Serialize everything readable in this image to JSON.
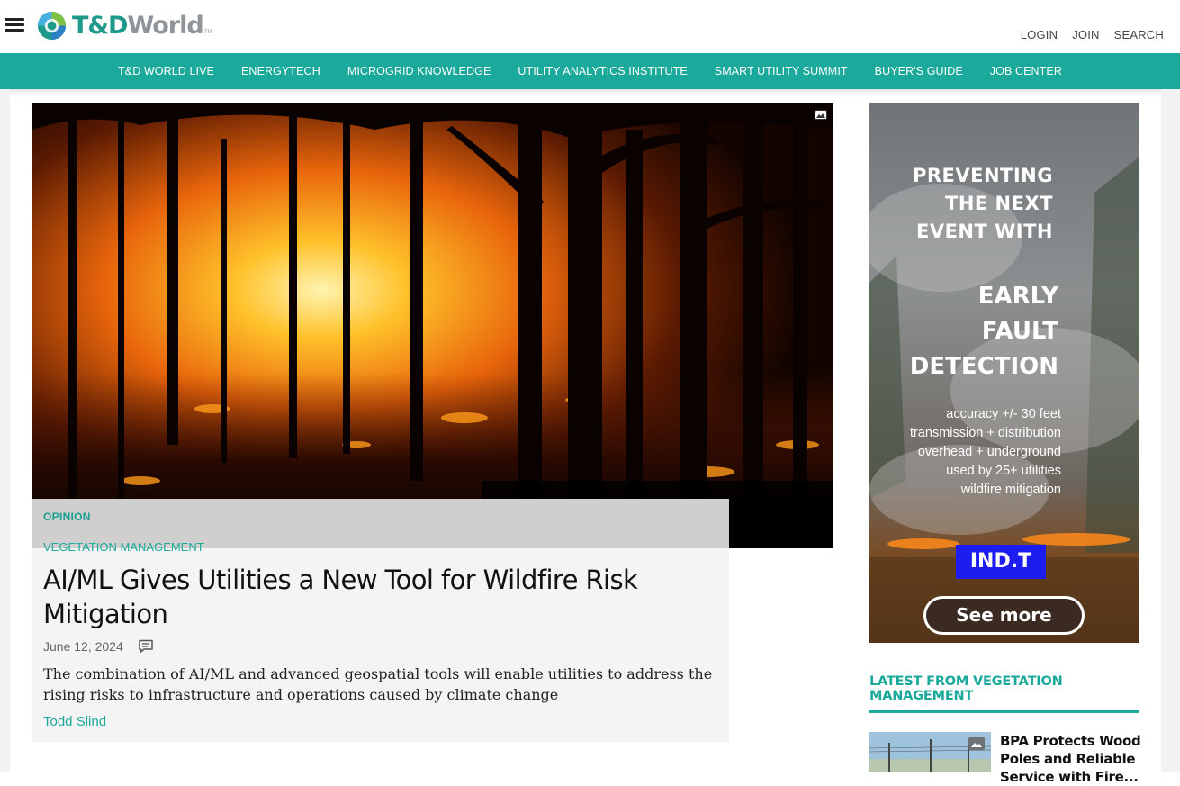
{
  "header": {
    "logo": {
      "td": "T&D",
      "world": "World",
      "tm": "TM"
    },
    "top_links": [
      "LOGIN",
      "JOIN",
      "SEARCH"
    ]
  },
  "nav": {
    "items": [
      "T&D WORLD LIVE",
      "ENERGYTECH",
      "MICROGRID KNOWLEDGE",
      "UTILITY ANALYTICS INSTITUTE",
      "SMART UTILITY SUMMIT",
      "BUYER'S GUIDE",
      "JOB CENTER"
    ],
    "color": "#1aa99a"
  },
  "article": {
    "label": "OPINION",
    "category": "VEGETATION MANAGEMENT",
    "headline": "AI/ML Gives Utilities a New Tool for Wildfire Risk Mitigation",
    "date": "June 12, 2024",
    "summary": "The combination of AI/ML and advanced geospatial tools will enable utilities to address the rising risks to infrastructure and operations caused by climate change",
    "author": "Todd Slind",
    "image_icon": "image-icon",
    "comment_icon": "comment-icon"
  },
  "ad": {
    "headline_1": [
      "PREVENTING",
      "THE NEXT",
      "EVENT WITH"
    ],
    "headline_2": [
      "EARLY",
      "FAULT",
      "DETECTION"
    ],
    "features": [
      "accuracy +/- 30 feet",
      "transmission + distribution",
      "overhead + underground",
      "used by 25+ utilities",
      "wildfire mitigation"
    ],
    "brand": "IND.T",
    "cta": "See more",
    "brand_color": "#1d1df0"
  },
  "latest": {
    "title": "LATEST FROM VEGETATION MANAGEMENT",
    "items": [
      {
        "title": "BPA Protects Wood Poles and Reliable Service with Fire..."
      }
    ]
  }
}
